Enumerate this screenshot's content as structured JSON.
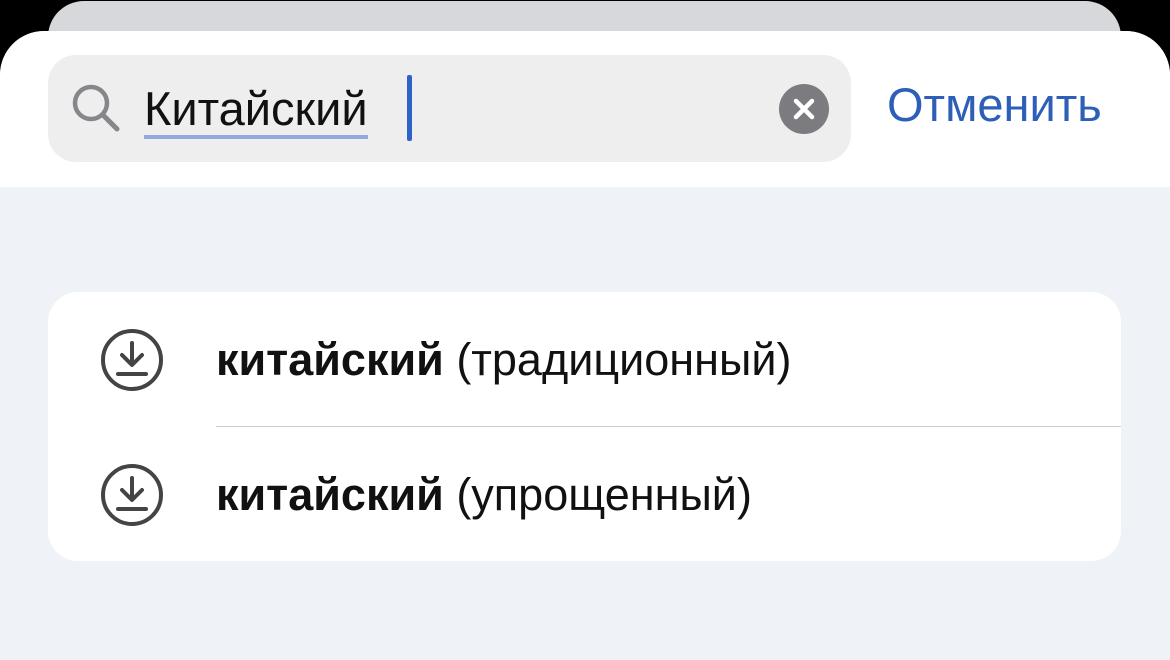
{
  "search": {
    "value": "Китайский",
    "cancel_label": "Отменить"
  },
  "icons": {
    "search": "search-icon",
    "clear": "clear-circle-icon",
    "download": "download-icon"
  },
  "results": [
    {
      "bold": "китайский",
      "rest": "(традиционный)"
    },
    {
      "bold": "китайский",
      "rest": "(упрощенный)"
    }
  ],
  "colors": {
    "accent": "#2e5fb8",
    "caret": "#2e62c8",
    "background": "#eff2f6",
    "field": "#eeeeef"
  }
}
